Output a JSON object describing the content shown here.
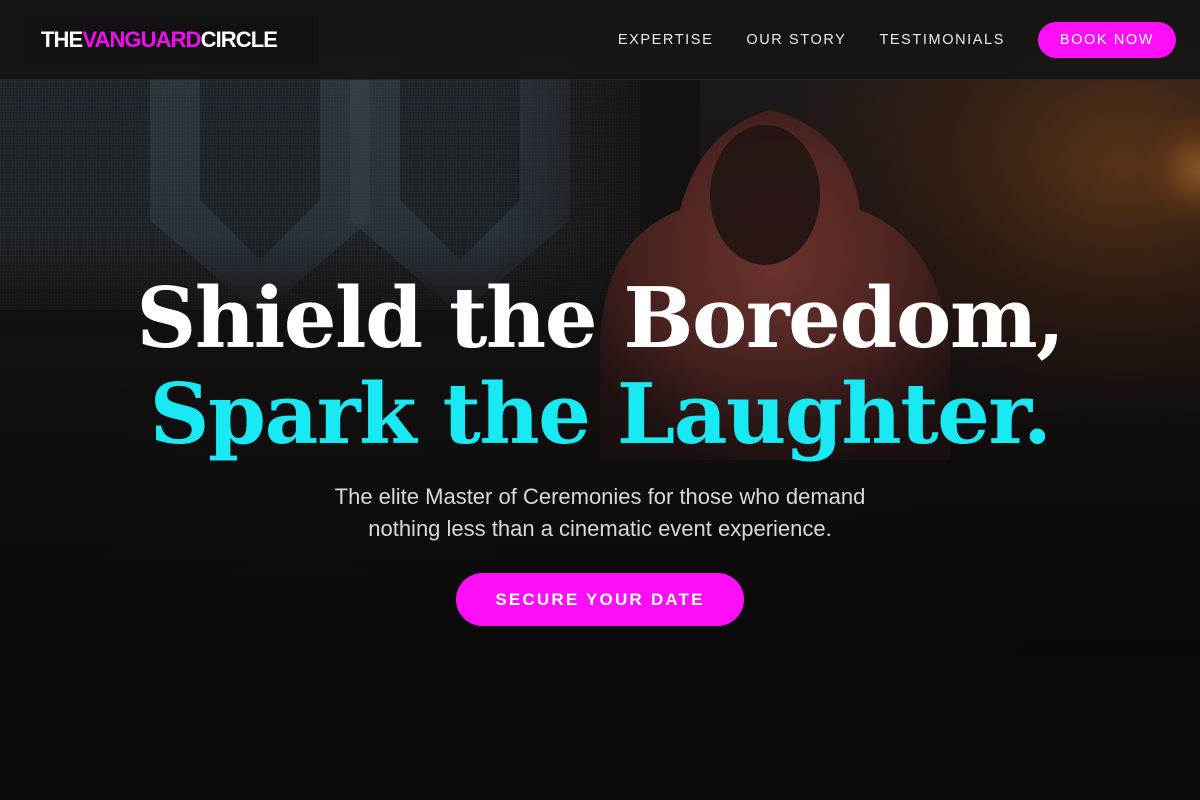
{
  "brand": {
    "logo_part1": "THE ",
    "logo_part2": "VANGUARD",
    "logo_part3": " CIRCLE"
  },
  "nav": {
    "links": [
      "EXPERTISE",
      "OUR STORY",
      "TESTIMONIALS"
    ],
    "cta_label": "BOOK NOW"
  },
  "hero": {
    "title_line1": "Shield the Boredom,",
    "title_line2": "Spark the Laughter.",
    "subtitle_line1": "The elite Master of Ceremonies for those who demand",
    "subtitle_line2": "nothing less than a cinematic event experience.",
    "cta_label": "SECURE YOUR DATE"
  },
  "colors": {
    "accent_magenta": "#ff0ff7",
    "accent_cyan": "#18e9f3",
    "background": "#0b0a0a"
  }
}
